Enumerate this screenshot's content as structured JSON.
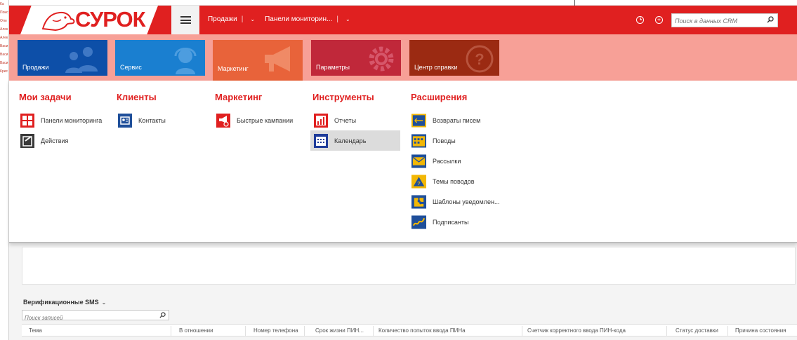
{
  "header": {
    "brand": "СУРОК",
    "nav": [
      {
        "label": "Продажи"
      },
      {
        "label": "Панели мониторин..."
      }
    ],
    "search_placeholder": "Поиск в данных CRM"
  },
  "tiles": [
    {
      "label": "Продажи",
      "color": "#0d4fa8"
    },
    {
      "label": "Сервис",
      "color": "#1a7fd0"
    },
    {
      "label": "Маркетинг",
      "color": "#e8633a"
    },
    {
      "label": "Параметры",
      "color": "#c0283a"
    },
    {
      "label": "Центр справки",
      "color": "#9b2a12"
    }
  ],
  "menu": {
    "columns": [
      {
        "title": "Мои задачи",
        "items": [
          "Панели мониторинга",
          "Действия"
        ]
      },
      {
        "title": "Клиенты",
        "items": [
          "Контакты"
        ]
      },
      {
        "title": "Маркетинг",
        "items": [
          "Быстрые кампании"
        ]
      },
      {
        "title": "Инструменты",
        "items": [
          "Отчеты",
          "Календарь"
        ]
      },
      {
        "title": "Расширения",
        "items": [
          "Возвраты писем",
          "Поводы",
          "Рассылки",
          "Темы поводов",
          "Шаблоны уведомлен...",
          "Подписанты"
        ]
      }
    ],
    "selected": "Календарь"
  },
  "view": {
    "title": "Верификационные SMS",
    "search_placeholder": "Поиск записей",
    "columns": [
      "Тема",
      "В отношении",
      "Номер телефона",
      "Срок жизни ПИН...",
      "Количество попыток ввода ПИНа",
      "Счетчик корректного ввода ПИН-кода",
      "Статус доставки",
      "Причина состояния"
    ]
  },
  "left_sliver": [
    "Ка",
    "Поиск",
    "Отм",
    "Алек",
    "Алек",
    "Васи",
    "Васи",
    "Васи",
    "Крис"
  ],
  "colors": {
    "accent": "#e02020",
    "band": "#f7a097"
  }
}
